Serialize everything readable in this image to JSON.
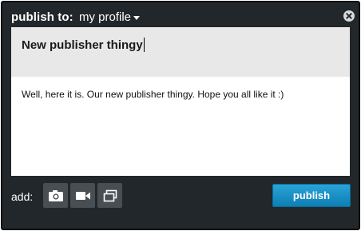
{
  "header": {
    "label": "publish to:",
    "profile_select": "my profile"
  },
  "composer": {
    "title": "New publisher thingy",
    "body": "Well, here it is. Our new publisher thingy. Hope you all like it :)"
  },
  "footer": {
    "add_label": "add:",
    "attachments": [
      {
        "icon": "camera-icon"
      },
      {
        "icon": "video-camera-icon"
      },
      {
        "icon": "link-preview-icon"
      }
    ],
    "publish_label": "publish"
  },
  "colors": {
    "window_bg": "#22272b",
    "title_bg": "#e8e8e8",
    "publish_button": "#1b92c7",
    "attach_button": "#494e52"
  }
}
